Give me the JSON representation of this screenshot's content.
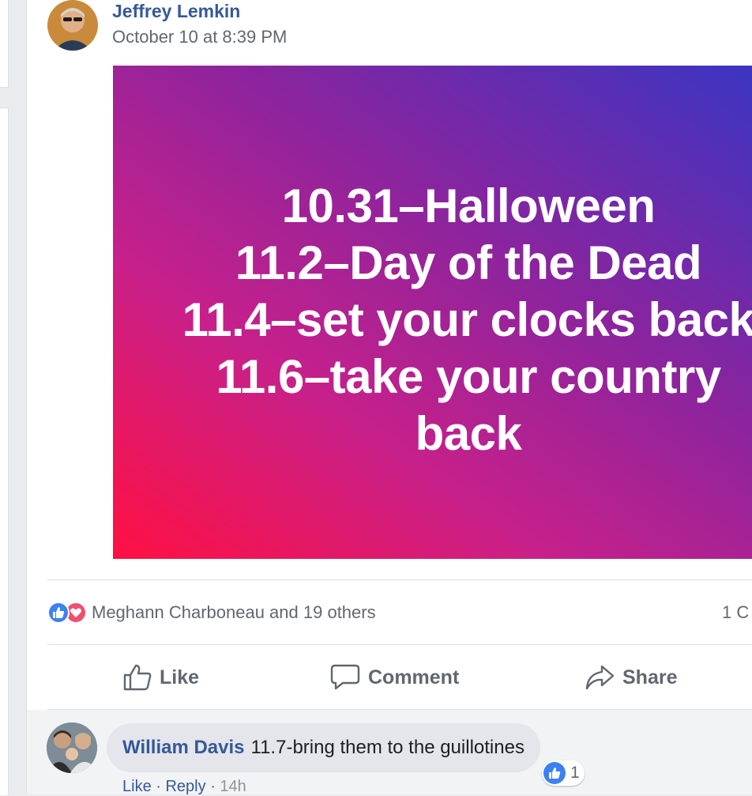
{
  "post": {
    "author": "Jeffrey Lemkin",
    "timestamp": "October 10 at 8:39 PM",
    "image_lines": [
      "10.31–Halloween",
      "11.2–Day of the Dead",
      "11.4–set your clocks back",
      "11.6–take your country",
      "back"
    ]
  },
  "reactions": {
    "icons": [
      "like-icon",
      "love-icon"
    ],
    "names": "Meghann Charboneau and 19 others",
    "comment_count": "1 C"
  },
  "actions": {
    "like": "Like",
    "comment": "Comment",
    "share": "Share"
  },
  "comment": {
    "author": "William Davis",
    "text": "11.7-bring them to the guillotines",
    "like_count": "1",
    "like_label": "Like",
    "reply_label": "Reply",
    "age": "14h"
  },
  "colors": {
    "link": "#365899",
    "gradient_start": "#ff1042",
    "gradient_end": "#3a35c2",
    "like_blue": "#3b82f0",
    "love_red": "#f0506e"
  }
}
